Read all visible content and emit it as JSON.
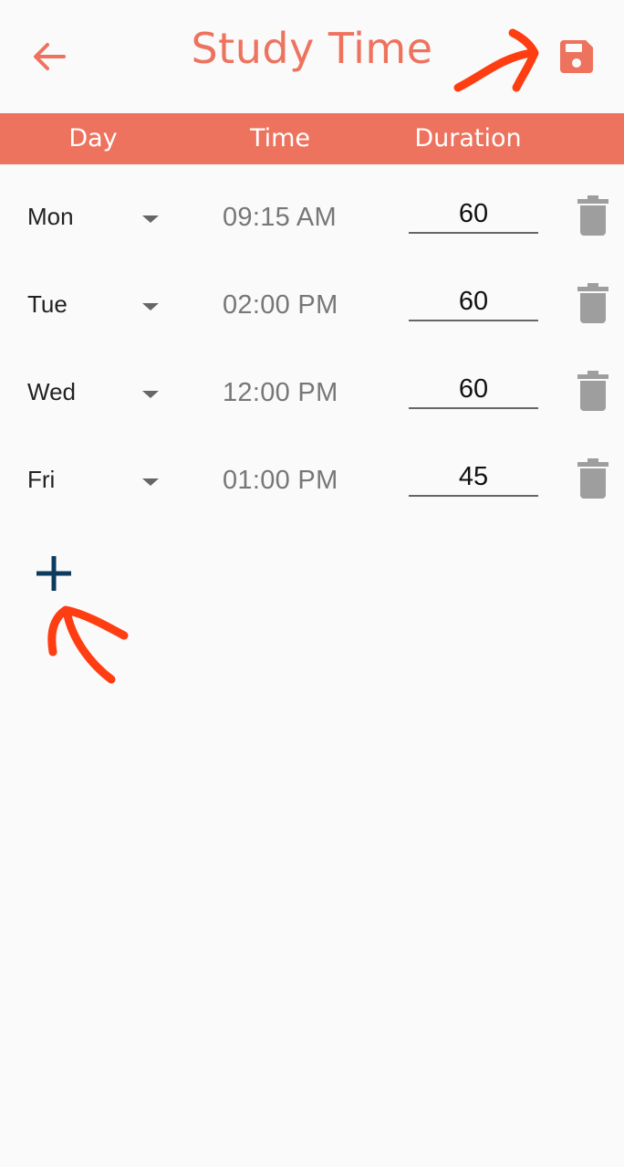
{
  "appbar": {
    "title": "Study Time",
    "back_icon": "arrow-left-icon",
    "save_icon": "floppy-disk-icon"
  },
  "table_header": {
    "day": "Day",
    "time": "Time",
    "duration": "Duration"
  },
  "rows": [
    {
      "day": "Mon",
      "time": "09:15 AM",
      "duration": "60"
    },
    {
      "day": "Tue",
      "time": "02:00 PM",
      "duration": "60"
    },
    {
      "day": "Wed",
      "time": "12:00 PM",
      "duration": "60"
    },
    {
      "day": "Fri",
      "time": "01:00 PM",
      "duration": "45"
    }
  ],
  "icons": {
    "dropdown": "caret-down-icon",
    "delete": "trash-icon",
    "add": "plus-icon"
  },
  "colors": {
    "accent": "#ee735e",
    "add_icon": "#0d3b5e",
    "delete_icon": "#9e9e9e",
    "annotation": "#ff3d12"
  }
}
